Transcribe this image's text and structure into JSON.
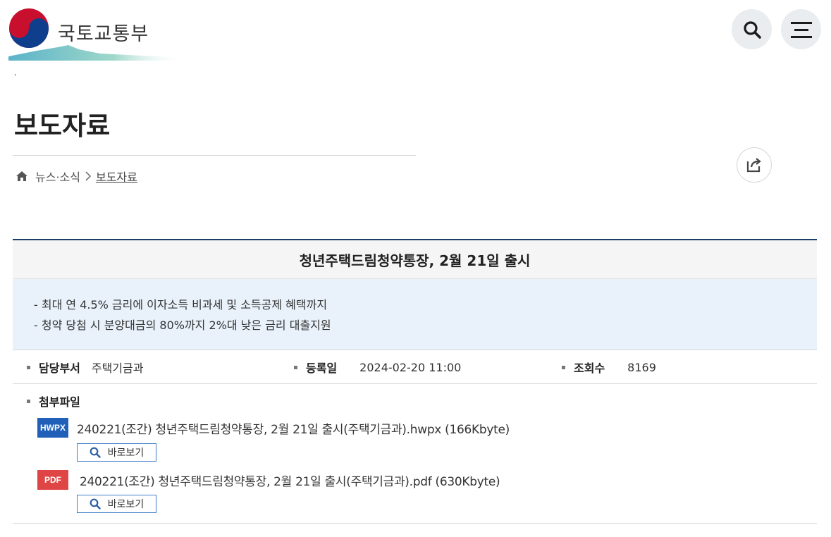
{
  "header": {
    "logo_text": "국토교통부",
    "dot": "."
  },
  "page": {
    "title": "보도자료"
  },
  "breadcrumb": {
    "items": [
      "뉴스·소식",
      "보도자료"
    ]
  },
  "article": {
    "title": "청년주택드림청약통장, 2월 21일 출시",
    "summary": [
      "최대 연 4.5% 금리에 이자소득 비과세 및 소득공제 혜택까지",
      "청약 당첨 시 분양대금의 80%까지 2%대 낮은 금리 대출지원"
    ],
    "meta": {
      "dept_label": "담당부서",
      "dept_value": "주택기금과",
      "date_label": "등록일",
      "date_value": "2024-02-20 11:00",
      "views_label": "조회수",
      "views_value": "8169"
    },
    "attachments": {
      "label": "첨부파일",
      "files": [
        {
          "type": "HWPX",
          "name": "240221(조간) 청년주택드림청약통장, 2월 21일 출시(주택기금과).hwpx (166Kbyte)",
          "view_label": "바로보기"
        },
        {
          "type": "PDF",
          "name": "240221(조간) 청년주택드림청약통장, 2월 21일 출시(주택기금과).pdf (630Kbyte)",
          "view_label": "바로보기"
        }
      ]
    }
  },
  "colors": {
    "title_rule": "#1d3e64",
    "summary_bg": "#e9f2fb",
    "hwpx_badge": "#2060b8",
    "pdf_badge": "#e04545"
  },
  "icons": [
    "logo-emblem-icon",
    "search-icon",
    "menu-icon",
    "home-icon",
    "chevron-right-icon",
    "share-icon",
    "magnifier-icon"
  ]
}
